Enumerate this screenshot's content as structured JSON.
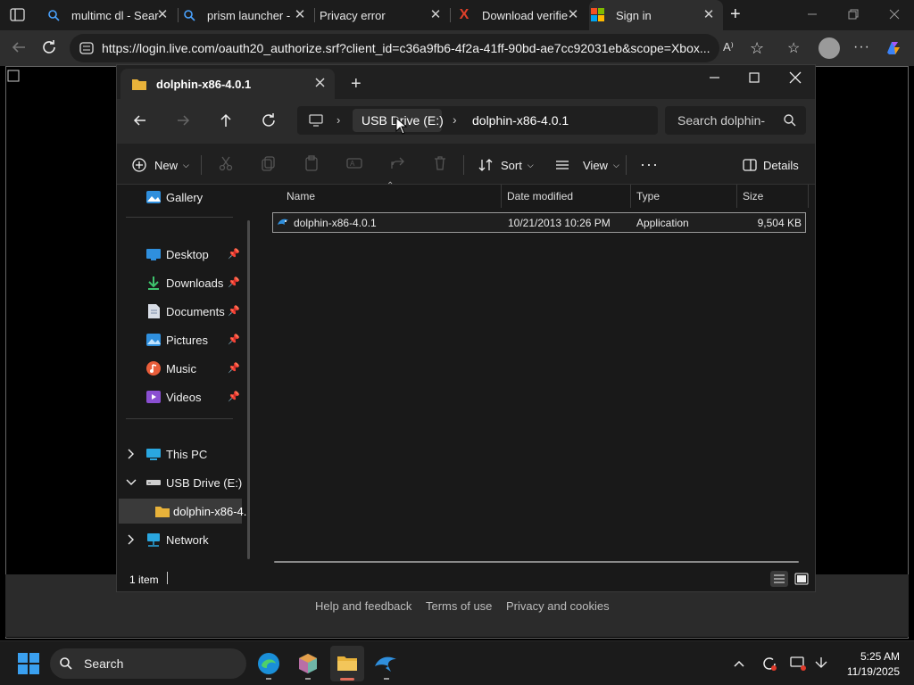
{
  "browser": {
    "tabs": [
      {
        "label": "multimc dl - Sear",
        "icon": "search-icon"
      },
      {
        "label": "prism launcher -",
        "icon": "search-icon"
      },
      {
        "label": "Privacy error",
        "icon": "none"
      },
      {
        "label": "Download verifie",
        "icon": "x-logo-icon"
      },
      {
        "label": "Sign in",
        "icon": "microsoft-logo-icon"
      }
    ],
    "active_tab_index": 4,
    "url": "https://login.live.com/oauth20_authorize.srf?client_id=c36a9fb6-4f2a-41ff-90bd-ae7cc92031eb&scope=Xbox..."
  },
  "page": {
    "footer_links": [
      "Help and feedback",
      "Terms of use",
      "Privacy and cookies"
    ]
  },
  "explorer": {
    "tab_title": "dolphin-x86-4.0.1",
    "breadcrumb": [
      "USB Drive (E:)",
      "dolphin-x86-4.0.1"
    ],
    "search_placeholder": "Search dolphin-",
    "commands": {
      "new": "New",
      "sort": "Sort",
      "view": "View",
      "details": "Details"
    },
    "nav": {
      "gallery": "Gallery",
      "quick_access": [
        {
          "label": "Desktop",
          "icon": "desktop-icon"
        },
        {
          "label": "Downloads",
          "icon": "download-icon"
        },
        {
          "label": "Documents",
          "icon": "document-icon"
        },
        {
          "label": "Pictures",
          "icon": "pictures-icon"
        },
        {
          "label": "Music",
          "icon": "music-icon"
        },
        {
          "label": "Videos",
          "icon": "videos-icon"
        }
      ],
      "this_pc": "This PC",
      "usb_drive": "USB Drive (E:)",
      "folder": "dolphin-x86-4.",
      "network": "Network"
    },
    "columns": {
      "name": "Name",
      "date": "Date modified",
      "type": "Type",
      "size": "Size"
    },
    "files": [
      {
        "name": "dolphin-x86-4.0.1",
        "date": "10/21/2013 10:26 PM",
        "type": "Application",
        "size": "9,504 KB"
      }
    ],
    "status": "1 item"
  },
  "taskbar": {
    "search_label": "Search",
    "time": "5:25 AM",
    "date": "11/19/2025"
  },
  "colors": {
    "accent": "#0078d4",
    "folder": "#e8b23a",
    "edge_red": "#c42b1c"
  }
}
